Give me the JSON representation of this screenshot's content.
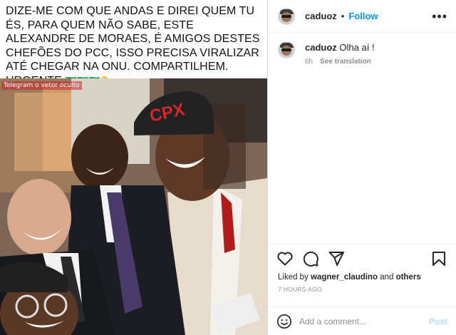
{
  "post": {
    "caption_overlay": "DIZE-ME COM QUE ANDAS E DIREI QUEM TU ÉS, PARA QUEM NÃO SABE, ESTE ALEXANDRE DE MORAES, É AMIGOS DESTES CHEFÕES DO PCC, ISSO PRECISA VIRALIZAR ATÉ CHEGAR NA ONU. COMPARTILHEM. URGENTE",
    "caption_emoji": "🇧🇷🇧🇷🇧🇷👇",
    "watermark": "Telegram o vetor oculto",
    "cap_text": "CPX"
  },
  "header": {
    "username": "caduoz",
    "separator": "•",
    "follow_label": "Follow",
    "more_label": "•••"
  },
  "comment": {
    "username": "caduoz",
    "text": "Olha aí !",
    "age": "6h",
    "translate_label": "See translation"
  },
  "actions": {
    "icons": [
      "heart-icon",
      "comment-icon",
      "share-icon",
      "bookmark-icon"
    ]
  },
  "likes": {
    "prefix": "Liked by",
    "user": "wagner_claudino",
    "joiner": "and",
    "others": "others"
  },
  "timestamp": "7 HOURS AGO",
  "add_comment": {
    "placeholder": "Add a comment...",
    "post_label": "Post"
  },
  "colors": {
    "accent": "#0095f6",
    "post_disabled": "#b2dffc",
    "muted": "#8e8e8e",
    "border": "#dbdbdb"
  }
}
